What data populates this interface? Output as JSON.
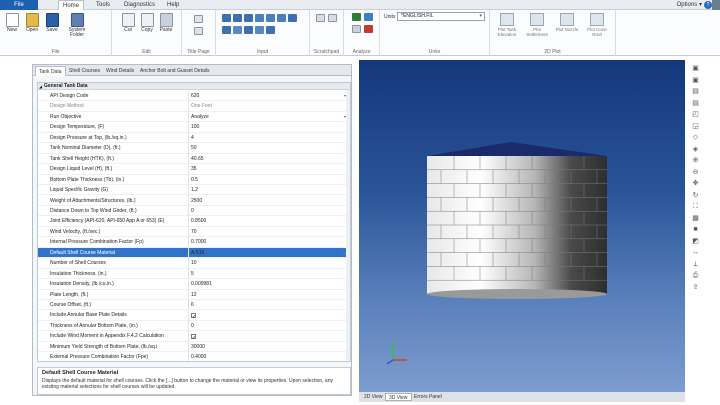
{
  "menu": {
    "file": "File",
    "tabs": [
      "Home",
      "Tools",
      "Diagnostics",
      "Help"
    ],
    "options": "Options"
  },
  "ribbon": {
    "file_group": {
      "label": "File",
      "buttons": [
        "New",
        "Open",
        "Save",
        "System Folder"
      ]
    },
    "edit_group": {
      "label": "Edit",
      "buttons": [
        "Cut",
        "Copy",
        "Paste"
      ]
    },
    "title_page_group": {
      "label": "Title Page"
    },
    "input_group": {
      "label": "Input"
    },
    "scratchpad_group": {
      "label": "Scratchpad"
    },
    "analyze_group": {
      "label": "Analyze"
    },
    "units_group": {
      "label": "Units",
      "units_label": "Units :",
      "units_value": "*ENGLISH.FIL"
    },
    "plot_group": {
      "label": "2D Plot",
      "buttons": [
        "Plot Tank Elevation",
        "Plot Settlement",
        "Plot Nozzle",
        "Plot Cone Roof"
      ]
    }
  },
  "panel_tabs": [
    "Tank Data",
    "Shell Courses",
    "Wind Details",
    "Anchor Bolt and Gusset Details"
  ],
  "grid": {
    "section": "General Tank Data",
    "rows": [
      {
        "key": "API Design Code",
        "value": "620",
        "dropdown": true
      },
      {
        "key": "Design Method",
        "value": "One Foot",
        "disabled": true
      },
      {
        "key": "Run Objective",
        "value": "Analyze",
        "dropdown": true
      },
      {
        "key": "Design Temperature, (F)",
        "value": "100"
      },
      {
        "key": "Design Pressure at Top, (lb./sq.in.)",
        "value": "4"
      },
      {
        "key": "Tank Nominal Diameter (D), (ft.)",
        "value": "50"
      },
      {
        "key": "Tank Shell Height (HTK), (ft.)",
        "value": "40.65"
      },
      {
        "key": "Design Liquid Level (H), (ft.)",
        "value": "35"
      },
      {
        "key": "Bottom Plate Thickness (Tb), (in.)",
        "value": "0.5"
      },
      {
        "key": "Liquid Specific Gravity (G)",
        "value": "1.2"
      },
      {
        "key": "Weight of Attachments/Structures, (lb.)",
        "value": "2500"
      },
      {
        "key": "Distance Down to Top Wind Girder, (ft.)",
        "value": "0"
      },
      {
        "key": "Joint Efficiency (API-620, API-650 App A or 653) (E)",
        "value": "0.8500"
      },
      {
        "key": "Wind Velocity, (ft./sec.)",
        "value": "70"
      },
      {
        "key": "Internal Pressure Combination Factor (Fp)",
        "value": "0.7000"
      },
      {
        "key": "Default Shell Course Material",
        "value": "A-516",
        "selected": true
      },
      {
        "key": "Number of Shell Courses",
        "value": "10"
      },
      {
        "key": "Insulation Thickness, (in.)",
        "value": "5"
      },
      {
        "key": "Insulation Density, (lb./cu.in.)",
        "value": "0.009981"
      },
      {
        "key": "Plate Length, (ft.)",
        "value": "12"
      },
      {
        "key": "Course Offset, (ft.)",
        "value": "6"
      },
      {
        "key": "Include Annular Base Plate Details",
        "check": true
      },
      {
        "key": "Thickness of Annular Bottom Plate, (in.)",
        "value": "0"
      },
      {
        "key": "Include Wind Moment in Appendix F.4.2 Calculation",
        "check": true
      },
      {
        "key": "Minimum Yield Strength of Bottom Plate, (lb./sq.i",
        "value": "30000"
      },
      {
        "key": "External Pressure Combination Factor (Fpe)",
        "value": "0.4000"
      }
    ]
  },
  "description": {
    "title": "Default Shell Course Material",
    "body": "Displays the default material for shell courses. Click the [...] button to change the material or view its properties. Upon selection, any existing material selections for shell courses will be updated."
  },
  "view_tabs": [
    "2D View",
    "3D View",
    "Errors Panel"
  ],
  "colors": {
    "accent": "#1f5fb0",
    "selected_row": "#2f74c9"
  }
}
